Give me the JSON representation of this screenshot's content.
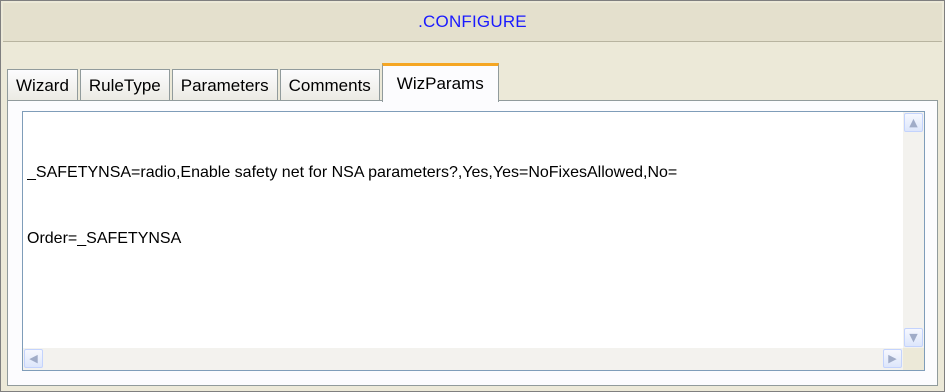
{
  "window": {
    "title": ".CONFIGURE"
  },
  "tabs": [
    {
      "label": "Wizard",
      "active": false
    },
    {
      "label": "RuleType",
      "active": false
    },
    {
      "label": "Parameters",
      "active": false
    },
    {
      "label": "Comments",
      "active": false
    },
    {
      "label": "WizParams",
      "active": true
    }
  ],
  "editor": {
    "lines": [
      "_SAFETYNSA=radio,Enable safety net for NSA parameters?,Yes,Yes=NoFixesAllowed,No=",
      "Order=_SAFETYNSA"
    ]
  },
  "scrollbars": {
    "up_icon": "▲",
    "down_icon": "▼",
    "left_icon": "◀",
    "right_icon": "▶"
  },
  "colors": {
    "title_text": "#1a1aff",
    "active_tab_accent": "#f5a623"
  }
}
